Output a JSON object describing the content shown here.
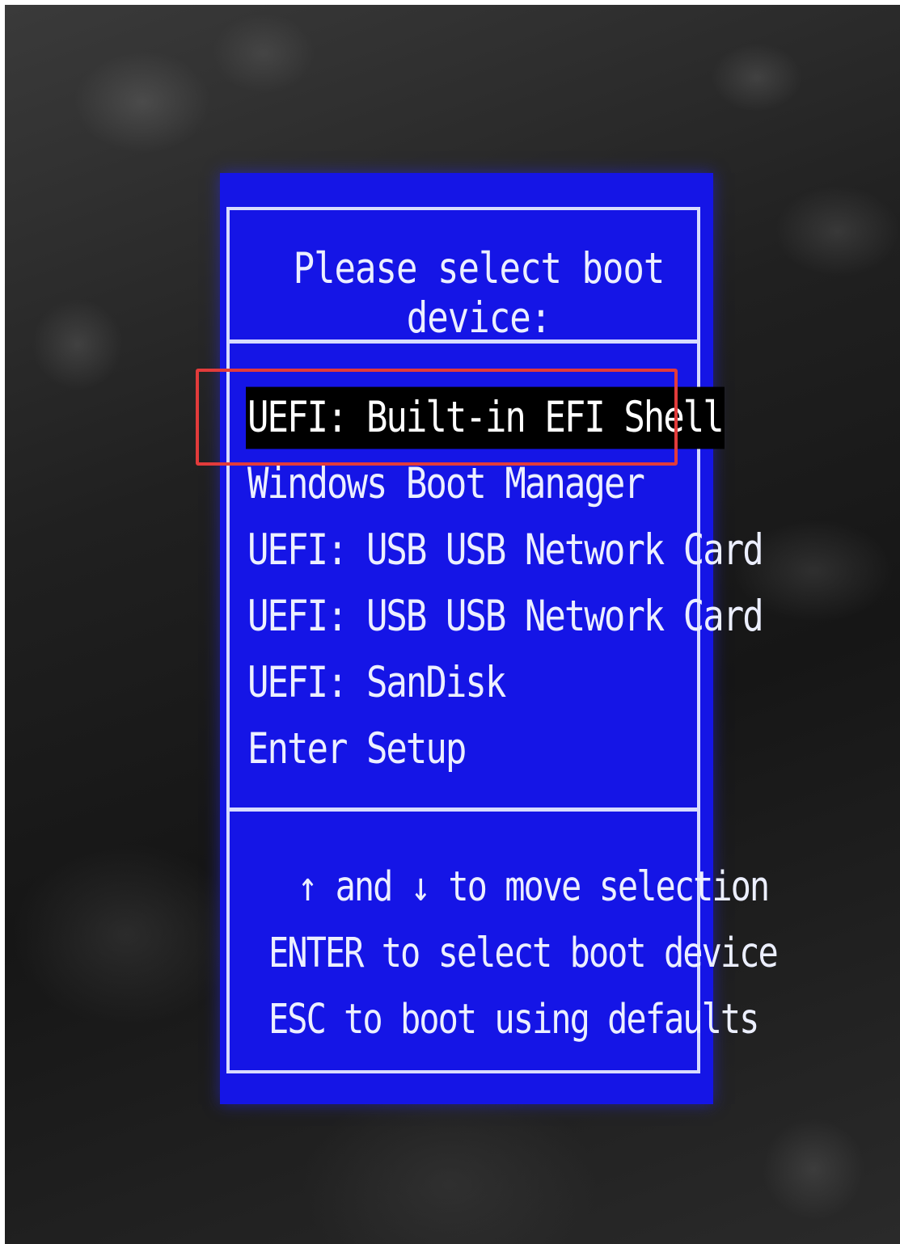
{
  "screen": {
    "title": "Please select boot device:",
    "selected_index": 0,
    "boot_options": [
      "UEFI: Built-in EFI Shell",
      "Windows Boot Manager",
      "UEFI: USB USB Network Card",
      "UEFI: USB USB Network Card",
      "UEFI: SanDisk",
      "Enter Setup"
    ],
    "help": {
      "move": {
        "up_arrow": "↑",
        "and": "and",
        "down_arrow": "↓",
        "text": "to move selection"
      },
      "enter": "ENTER to select boot device",
      "esc": "ESC to boot using defaults"
    }
  },
  "colors": {
    "bios_background": "#1515e6",
    "text": "#ecefff",
    "selection_background": "#000000",
    "annotation_box": "#e23b3b"
  }
}
